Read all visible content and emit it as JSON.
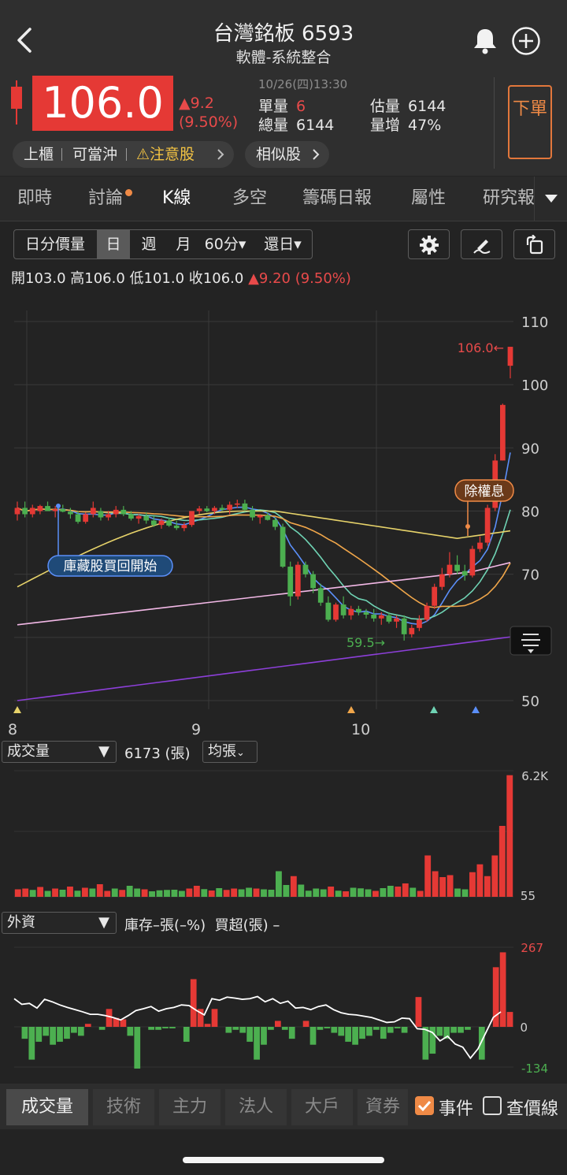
{
  "header": {
    "title": "台灣銘板 6593",
    "subtitle": "軟體-系統整合",
    "price": "106.0",
    "change": "▲9.2",
    "change_pct": "(9.50%)",
    "datetime": "10/26(四)13:30",
    "unit_vol_label": "單量",
    "unit_vol": "6",
    "total_vol_label": "總量",
    "total_vol": "6144",
    "est_vol_label": "估量",
    "est_vol": "6144",
    "vol_inc_label": "量增",
    "vol_inc": "47%",
    "order_button": "下單",
    "tags": [
      "上櫃",
      "可當沖",
      "⚠注意股"
    ],
    "similar_button": "相似股"
  },
  "tabs": [
    "即時",
    "討論",
    "K線",
    "多空",
    "籌碼日報",
    "屬性",
    "研究報告"
  ],
  "active_tab": "K線",
  "toolbar": {
    "segments": [
      "日分價量",
      "日",
      "週",
      "月",
      "60分▾",
      "還日▾"
    ],
    "active_segment": "日"
  },
  "ohlc": {
    "open_label": "開",
    "open": "103.0",
    "high_label": "高",
    "high": "106.0",
    "low_label": "低",
    "low": "101.0",
    "close_label": "收",
    "close": "106.0",
    "change": "▲9.20 (9.50%)"
  },
  "chart_data": [
    {
      "type": "candlestick",
      "y_ticks": [
        "110",
        "100",
        "90",
        "80",
        "70",
        "50"
      ],
      "ylim": [
        47,
        112
      ],
      "x_labels": [
        "8",
        "9",
        "10"
      ],
      "annotations": {
        "high_marker": "106.0←",
        "low_marker": "59.5→",
        "event_buyback": "庫藏股買回開始",
        "event_dividend": "除權息"
      },
      "candles": [
        {
          "o": 79.5,
          "h": 81.5,
          "l": 78.5,
          "c": 80.5
        },
        {
          "o": 80.5,
          "h": 81.5,
          "l": 79.0,
          "c": 79.5
        },
        {
          "o": 79.5,
          "h": 81.0,
          "l": 79.0,
          "c": 80.5
        },
        {
          "o": 80.0,
          "h": 81.0,
          "l": 79.5,
          "c": 80.8
        },
        {
          "o": 80.8,
          "h": 81.5,
          "l": 80.0,
          "c": 80.0
        },
        {
          "o": 80.0,
          "h": 80.8,
          "l": 79.0,
          "c": 80.3
        },
        {
          "o": 80.3,
          "h": 81.0,
          "l": 79.8,
          "c": 79.9
        },
        {
          "o": 79.9,
          "h": 80.5,
          "l": 78.8,
          "c": 79.5
        },
        {
          "o": 79.5,
          "h": 80.0,
          "l": 78.0,
          "c": 78.3
        },
        {
          "o": 78.3,
          "h": 79.8,
          "l": 78.0,
          "c": 79.5
        },
        {
          "o": 79.5,
          "h": 81.5,
          "l": 79.0,
          "c": 80.5
        },
        {
          "o": 80.0,
          "h": 80.5,
          "l": 78.5,
          "c": 79.0
        },
        {
          "o": 79.0,
          "h": 80.0,
          "l": 78.5,
          "c": 79.5
        },
        {
          "o": 79.5,
          "h": 80.8,
          "l": 79.0,
          "c": 80.2
        },
        {
          "o": 80.2,
          "h": 80.8,
          "l": 79.2,
          "c": 79.5
        },
        {
          "o": 79.5,
          "h": 80.0,
          "l": 78.5,
          "c": 78.8
        },
        {
          "o": 78.8,
          "h": 79.5,
          "l": 78.0,
          "c": 79.2
        },
        {
          "o": 79.2,
          "h": 79.8,
          "l": 78.0,
          "c": 78.5
        },
        {
          "o": 78.5,
          "h": 79.2,
          "l": 77.5,
          "c": 77.8
        },
        {
          "o": 77.8,
          "h": 78.8,
          "l": 77.2,
          "c": 78.5
        },
        {
          "o": 78.5,
          "h": 79.0,
          "l": 77.5,
          "c": 77.7
        },
        {
          "o": 77.7,
          "h": 78.5,
          "l": 77.0,
          "c": 77.3
        },
        {
          "o": 77.3,
          "h": 78.2,
          "l": 76.8,
          "c": 77.8
        },
        {
          "o": 77.8,
          "h": 79.5,
          "l": 77.5,
          "c": 80.0
        },
        {
          "o": 80.0,
          "h": 80.8,
          "l": 79.5,
          "c": 80.4
        },
        {
          "o": 80.4,
          "h": 80.8,
          "l": 79.8,
          "c": 80.0
        },
        {
          "o": 80.0,
          "h": 80.8,
          "l": 79.5,
          "c": 80.5
        },
        {
          "o": 80.5,
          "h": 81.0,
          "l": 80.0,
          "c": 80.2
        },
        {
          "o": 80.2,
          "h": 81.5,
          "l": 79.5,
          "c": 81.0
        },
        {
          "o": 81.0,
          "h": 81.8,
          "l": 80.5,
          "c": 81.2
        },
        {
          "o": 81.2,
          "h": 81.8,
          "l": 80.0,
          "c": 80.2
        },
        {
          "o": 80.2,
          "h": 80.8,
          "l": 78.5,
          "c": 79.0
        },
        {
          "o": 79.0,
          "h": 79.5,
          "l": 78.0,
          "c": 79.3
        },
        {
          "o": 79.3,
          "h": 79.8,
          "l": 78.5,
          "c": 78.6
        },
        {
          "o": 78.6,
          "h": 79.0,
          "l": 77.0,
          "c": 77.5
        },
        {
          "o": 77.5,
          "h": 78.0,
          "l": 71.0,
          "c": 71.2
        },
        {
          "o": 71.2,
          "h": 72.0,
          "l": 65.0,
          "c": 66.5
        },
        {
          "o": 66.5,
          "h": 72.0,
          "l": 66.0,
          "c": 71.5
        },
        {
          "o": 71.5,
          "h": 72.0,
          "l": 69.5,
          "c": 70.0
        },
        {
          "o": 70.0,
          "h": 70.5,
          "l": 67.0,
          "c": 67.8
        },
        {
          "o": 67.8,
          "h": 68.5,
          "l": 65.0,
          "c": 65.5
        },
        {
          "o": 65.5,
          "h": 66.5,
          "l": 62.5,
          "c": 62.8
        },
        {
          "o": 62.8,
          "h": 65.5,
          "l": 62.5,
          "c": 65.2
        },
        {
          "o": 65.2,
          "h": 66.5,
          "l": 63.0,
          "c": 63.5
        },
        {
          "o": 63.5,
          "h": 65.0,
          "l": 62.8,
          "c": 64.5
        },
        {
          "o": 64.5,
          "h": 65.0,
          "l": 63.5,
          "c": 64.0
        },
        {
          "o": 64.0,
          "h": 64.5,
          "l": 63.0,
          "c": 63.6
        },
        {
          "o": 63.6,
          "h": 64.5,
          "l": 62.5,
          "c": 63.0
        },
        {
          "o": 63.0,
          "h": 64.0,
          "l": 62.0,
          "c": 63.5
        },
        {
          "o": 63.5,
          "h": 64.0,
          "l": 62.2,
          "c": 62.5
        },
        {
          "o": 62.5,
          "h": 63.5,
          "l": 61.5,
          "c": 63.0
        },
        {
          "o": 63.0,
          "h": 63.5,
          "l": 59.5,
          "c": 60.5
        },
        {
          "o": 60.5,
          "h": 62.0,
          "l": 60.0,
          "c": 61.5
        },
        {
          "o": 61.5,
          "h": 63.5,
          "l": 61.0,
          "c": 62.8
        },
        {
          "o": 62.8,
          "h": 65.5,
          "l": 62.5,
          "c": 65.0
        },
        {
          "o": 65.0,
          "h": 68.5,
          "l": 64.5,
          "c": 68.0
        },
        {
          "o": 68.0,
          "h": 71.0,
          "l": 67.5,
          "c": 70.0
        },
        {
          "o": 70.0,
          "h": 73.5,
          "l": 69.5,
          "c": 71.5
        },
        {
          "o": 71.5,
          "h": 73.0,
          "l": 70.0,
          "c": 70.5
        },
        {
          "o": 70.5,
          "h": 71.5,
          "l": 69.0,
          "c": 69.8
        },
        {
          "o": 69.8,
          "h": 74.5,
          "l": 69.5,
          "c": 74.0
        },
        {
          "o": 74.0,
          "h": 76.0,
          "l": 73.5,
          "c": 75.0
        },
        {
          "o": 75.0,
          "h": 81.0,
          "l": 74.5,
          "c": 80.5
        },
        {
          "o": 80.5,
          "h": 89.0,
          "l": 80.0,
          "c": 88.0
        },
        {
          "o": 88.0,
          "h": 97.0,
          "l": 88.0,
          "c": 96.8
        },
        {
          "o": 103.0,
          "h": 106.0,
          "l": 101.0,
          "c": 106.0
        }
      ]
    },
    {
      "type": "bar",
      "title": "成交量",
      "value_label": "6173 (張)",
      "mode": "均張",
      "ymax_label": "6.2K",
      "ymin_label": "55",
      "values": [
        380,
        420,
        350,
        500,
        300,
        420,
        360,
        520,
        310,
        460,
        420,
        640,
        300,
        420,
        350,
        560,
        420,
        380,
        280,
        330,
        350,
        360,
        300,
        420,
        560,
        390,
        320,
        440,
        350,
        420,
        380,
        460,
        420,
        380,
        360,
        1300,
        600,
        1050,
        620,
        310,
        420,
        380,
        520,
        310,
        280,
        460,
        430,
        380,
        300,
        440,
        560,
        520,
        680,
        460,
        300,
        2100,
        1300,
        1000,
        1100,
        420,
        380,
        1250,
        1650,
        1050,
        2100,
        3600,
        6173
      ],
      "colors": [
        "#e53935",
        "#e53935",
        "#4caf50",
        "#e53935",
        "#4caf50",
        "#e53935",
        "#4caf50",
        "#e53935",
        "#4caf50",
        "#e53935",
        "#4caf50",
        "#e53935",
        "#e53935",
        "#4caf50",
        "#e53935",
        "#4caf50",
        "#4caf50",
        "#e53935",
        "#4caf50",
        "#4caf50",
        "#4caf50",
        "#4caf50",
        "#4caf50",
        "#e53935",
        "#e53935",
        "#4caf50",
        "#e53935",
        "#4caf50",
        "#e53935",
        "#e53935",
        "#4caf50",
        "#4caf50",
        "#e53935",
        "#4caf50",
        "#4caf50",
        "#4caf50",
        "#4caf50",
        "#e53935",
        "#4caf50",
        "#4caf50",
        "#4caf50",
        "#4caf50",
        "#e53935",
        "#4caf50",
        "#e53935",
        "#4caf50",
        "#4caf50",
        "#4caf50",
        "#e53935",
        "#4caf50",
        "#4caf50",
        "#e53935",
        "#e53935",
        "#4caf50",
        "#e53935",
        "#e53935",
        "#e53935",
        "#e53935",
        "#e53935",
        "#4caf50",
        "#4caf50",
        "#e53935",
        "#e53935",
        "#e53935",
        "#e53935",
        "#e53935",
        "#e53935"
      ]
    },
    {
      "type": "bar",
      "title": "外資",
      "caption": "庫存–張(–%)  買超(張) –",
      "ymax_label": "267",
      "zero_label": "0",
      "ymin_label": "-134",
      "net_buy": [
        0,
        -40,
        -110,
        -50,
        -30,
        -60,
        -50,
        -40,
        -20,
        -30,
        10,
        0,
        -10,
        60,
        30,
        25,
        -30,
        -140,
        0,
        -10,
        -10,
        -5,
        -5,
        0,
        -50,
        160,
        60,
        10,
        60,
        0,
        -20,
        -10,
        -20,
        -50,
        -110,
        -60,
        -10,
        20,
        -10,
        -40,
        0,
        20,
        -60,
        -10,
        -5,
        -20,
        -30,
        -50,
        -60,
        -40,
        -30,
        -10,
        -40,
        -20,
        -5,
        -20,
        0,
        100,
        -110,
        -90,
        -30,
        -40,
        -20,
        -20,
        -10,
        0,
        -110,
        0,
        200,
        250,
        50
      ],
      "inventory_line": [
        90,
        72,
        75,
        60,
        88,
        80,
        70,
        62,
        55,
        48,
        40,
        40,
        36,
        30,
        22,
        36,
        52,
        58,
        65,
        50,
        58,
        62,
        70,
        68,
        52,
        38,
        90,
        85,
        95,
        92,
        88,
        90,
        97,
        80,
        90,
        75,
        82,
        60,
        62,
        55,
        65,
        70,
        55,
        45,
        40,
        38,
        34,
        30,
        22,
        14,
        16,
        28,
        26,
        -6,
        -8,
        -18,
        -45,
        -30,
        -55,
        -65,
        -100,
        -70,
        -20,
        30,
        48
      ]
    }
  ],
  "bottom_tabs": [
    "成交量",
    "技術",
    "主力",
    "法人",
    "大戶",
    "資券"
  ],
  "active_bottom_tab": "成交量",
  "options": [
    {
      "label": "事件",
      "checked": true
    },
    {
      "label": "查價線",
      "checked": false
    }
  ],
  "colors": {
    "up": "#e53935",
    "down": "#4caf50",
    "accent": "#ef8a46"
  }
}
